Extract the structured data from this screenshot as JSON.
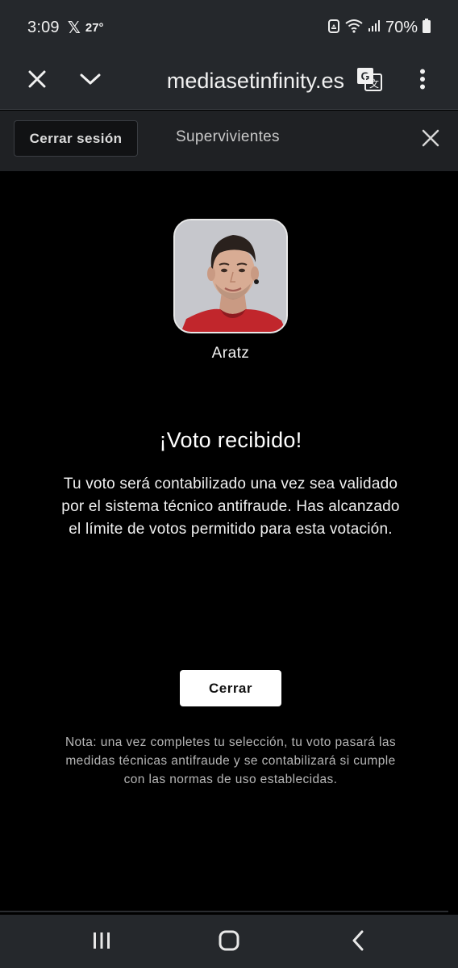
{
  "status_bar": {
    "time": "3:09",
    "x_glyph": "𝕏",
    "temperature": "27°",
    "battery_percent": "70%",
    "icons": [
      "recycle-notification-icon",
      "wifi-icon",
      "signal-icon",
      "battery-icon"
    ]
  },
  "browser": {
    "url": "mediasetinfinity.es",
    "icons": [
      "close-icon",
      "chevron-down-icon",
      "translate-icon",
      "more-vert-icon"
    ]
  },
  "page_header": {
    "logout_label": "Cerrar sesión",
    "title": "Supervivientes"
  },
  "vote": {
    "contestant_name": "Aratz",
    "title": "¡Voto recibido!",
    "message": "Tu voto será contabilizado una vez sea validado por el sistema técnico antifraude. Has alcanzado el límite de votos permitido para esta votación.",
    "close_label": "Cerrar",
    "note": "Nota: una vez completes tu selección, tu voto pasará las medidas técnicas antifraude y se contabilizará si cumple con las normas de uso establecidas."
  },
  "navbar": {
    "icons": [
      "recent-apps-icon",
      "home-icon",
      "back-icon"
    ]
  },
  "colors": {
    "chrome_bg": "#25282c",
    "page_bg": "#000000",
    "header_bg": "#1f2124",
    "jersey_red": "#c1262c"
  }
}
